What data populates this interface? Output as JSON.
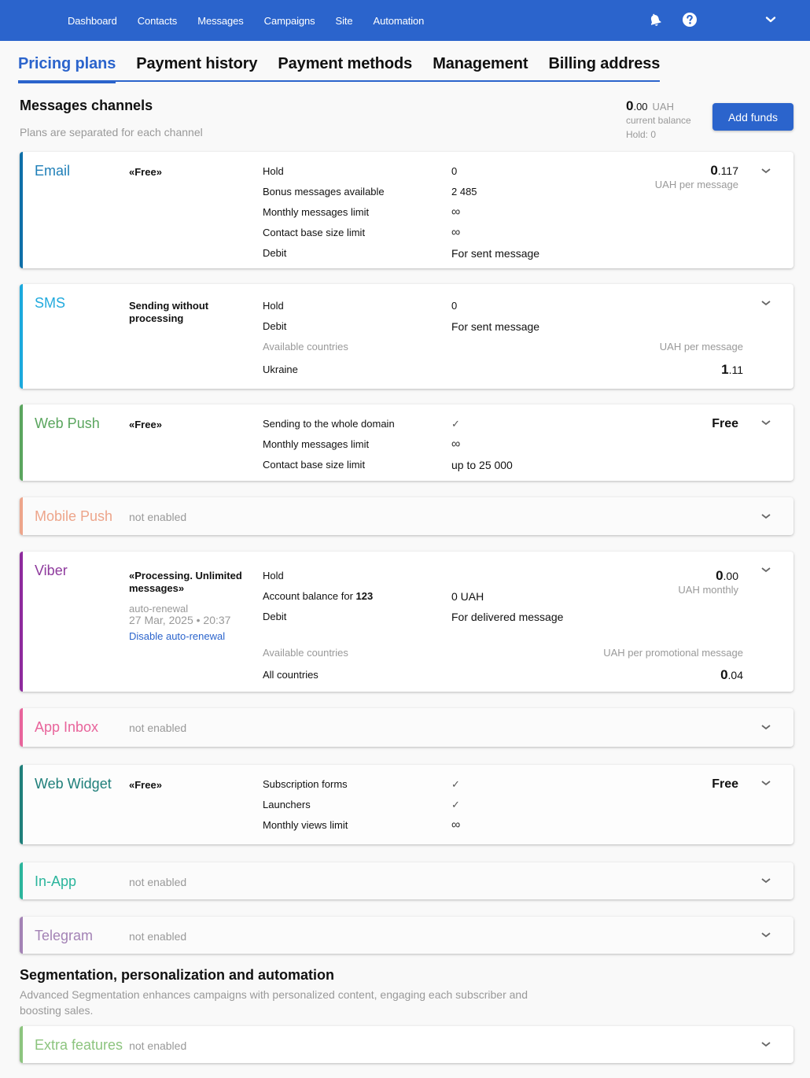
{
  "topnav": {
    "items": [
      "Dashboard",
      "Contacts",
      "Messages",
      "Campaigns",
      "Site",
      "Automation"
    ],
    "icons": [
      "bell-icon",
      "help-icon",
      "chevron-down-icon"
    ]
  },
  "tabs": [
    "Pricing plans",
    "Payment history",
    "Payment methods",
    "Management",
    "Billing address"
  ],
  "active_tab": "Pricing plans",
  "header": {
    "title": "Messages channels",
    "subtitle": "Plans are separated for each channel",
    "balance_int": "0",
    "balance_dec": ".00",
    "currency": "UAH",
    "balance_label": "current balance",
    "hold": "Hold: 0",
    "add_funds": "Add funds"
  },
  "email": {
    "name": "Email",
    "color": "#1f7fb8",
    "plan": "«Free»",
    "labels": [
      "Hold",
      "Bonus messages available",
      "Monthly messages limit",
      "Contact base size limit",
      "Debit"
    ],
    "values": [
      "0",
      "2 485",
      "∞",
      "∞",
      "For sent message"
    ],
    "price_int": "0",
    "price_dec": ".117",
    "price_unit": "UAH per message"
  },
  "sms": {
    "name": "SMS",
    "color": "#22aadd",
    "plan": "Sending without processing",
    "labels": [
      "Hold",
      "Debit"
    ],
    "values": [
      "0",
      "For sent message"
    ],
    "countries_label": "Available countries",
    "price_unit": "UAH per message",
    "country": "Ukraine",
    "price_int": "1",
    "price_dec": ".11"
  },
  "webpush": {
    "name": "Web Push",
    "color": "#5aa55e",
    "plan": "«Free»",
    "labels": [
      "Sending to the whole domain",
      "Monthly messages limit",
      "Contact base size limit"
    ],
    "values": [
      "✓",
      "∞",
      "up to 25 000"
    ],
    "price": "Free"
  },
  "mobilepush": {
    "name": "Mobile Push",
    "color": "#eda58b",
    "status": "not enabled"
  },
  "viber": {
    "name": "Viber",
    "color": "#8e3a9d",
    "plan": "«Processing. Unlimited messages»",
    "renewal_label": "auto-renewal",
    "renewal_date": "27 Mar, 2025 • 20:37",
    "disable_link": "Disable auto-renewal",
    "labels": [
      "Hold",
      "Account balance for",
      "Debit"
    ],
    "account_name": "123",
    "values": [
      "",
      "0 UAH",
      "For delivered message"
    ],
    "price_int": "0",
    "price_dec": ".00",
    "price_unit": "UAH monthly",
    "countries_label": "Available countries",
    "promo_unit": "UAH per promotional message",
    "country": "All countries",
    "promo_int": "0",
    "promo_dec": ".04"
  },
  "appinbox": {
    "name": "App Inbox",
    "color": "#e8649b",
    "status": "not enabled"
  },
  "webwidget": {
    "name": "Web Widget",
    "color": "#1f7f7a",
    "plan": "«Free»",
    "labels": [
      "Subscription forms",
      "Launchers",
      "Monthly views limit"
    ],
    "values": [
      "✓",
      "✓",
      "∞"
    ],
    "price": "Free"
  },
  "inapp": {
    "name": "In-App",
    "color": "#2bb59c",
    "status": "not enabled"
  },
  "telegram": {
    "name": "Telegram",
    "color": "#a382b5",
    "status": "not enabled"
  },
  "segmentation": {
    "title": "Segmentation, personalization and automation",
    "subtitle": "Advanced Segmentation enhances campaigns with personalized content, engaging each subscriber and boosting sales."
  },
  "extra": {
    "name": "Extra features",
    "color": "#8cc47e",
    "status": "not enabled"
  }
}
